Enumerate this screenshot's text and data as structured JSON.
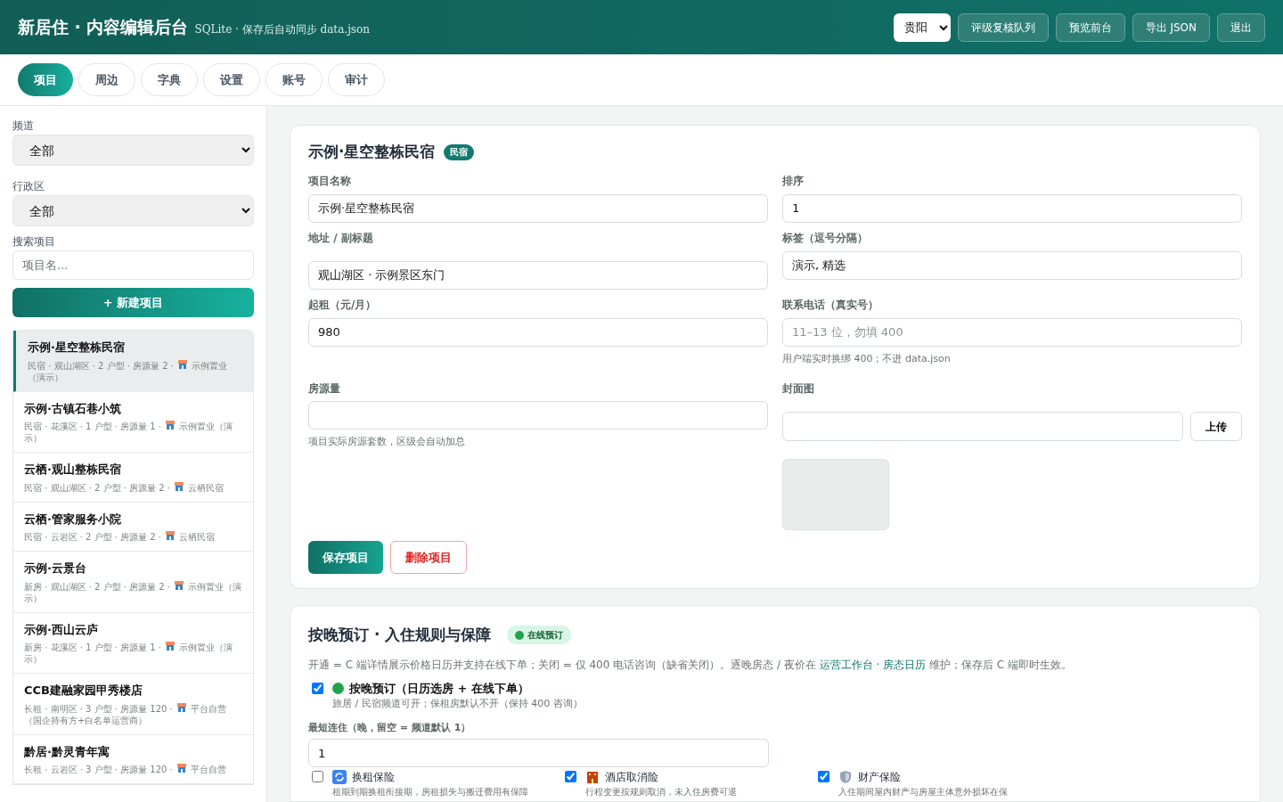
{
  "header": {
    "title": "新居住 · 内容编辑后台",
    "subtitle": "SQLite · 保存后自动同步 data.json",
    "city": "贵阳",
    "buttons": [
      "评级复核队列",
      "预览前台",
      "导出 JSON",
      "退出"
    ]
  },
  "tabs": [
    {
      "label": "项目",
      "selected": true
    },
    {
      "label": "周边",
      "selected": false
    },
    {
      "label": "字典",
      "selected": false
    },
    {
      "label": "设置",
      "selected": false
    },
    {
      "label": "账号",
      "selected": false
    },
    {
      "label": "审计",
      "selected": false
    }
  ],
  "sidebar": {
    "filters": [
      {
        "label": "频道",
        "value": "全部"
      },
      {
        "label": "行政区",
        "value": "全部"
      }
    ],
    "search": {
      "label": "搜索项目",
      "placeholder": "项目名..."
    },
    "new_button": "+ 新建项目",
    "items": [
      {
        "name": "示例·星空整栋民宿",
        "meta": "民宿 · 观山湖区 · 2 户型 · 房源量 2 ·",
        "owner": "示例置业（演示）",
        "selected": true
      },
      {
        "name": "示例·古镇石巷小筑",
        "meta": "民宿 · 花溪区 · 1 户型 · 房源量 1 ·",
        "owner": "示例置业（演示）",
        "selected": false
      },
      {
        "name": "云栖·观山整栋民宿",
        "meta": "民宿 · 观山湖区 · 2 户型 · 房源量 2 ·",
        "owner": "云栖民宿",
        "selected": false
      },
      {
        "name": "云栖·管家服务小院",
        "meta": "民宿 · 云岩区 · 2 户型 · 房源量 2 ·",
        "owner": "云栖民宿",
        "selected": false
      },
      {
        "name": "示例·云景台",
        "meta": "新房 · 观山湖区 · 2 户型 · 房源量 2 ·",
        "owner": "示例置业（演示）",
        "selected": false
      },
      {
        "name": "示例·西山云庐",
        "meta": "新房 · 花溪区 · 1 户型 · 房源量 1 ·",
        "owner": "示例置业（演示）",
        "selected": false
      },
      {
        "name": "CCB建融家园甲秀楼店",
        "meta": "长租 · 南明区 · 3 户型 · 房源量 120 ·",
        "owner": "平台自营（国企持有方+白名单运营商）",
        "selected": false
      },
      {
        "name": "黔居·黔灵青年寓",
        "meta": "长租 · 云岩区 · 3 户型 · 房源量 120 ·",
        "owner": "平台自营",
        "selected": false
      }
    ]
  },
  "project": {
    "title": "示例·星空整栋民宿",
    "badge": "民宿",
    "fields": [
      {
        "label": "项目名称",
        "value": "示例·星空整栋民宿"
      },
      {
        "label": "排序",
        "value": "1"
      },
      {
        "label": "地址 / 副标题",
        "value": "观山湖区 · 示例景区东门"
      },
      {
        "label": "标签（逗号分隔）",
        "value": "演示, 精选"
      },
      {
        "label": "起租（元/月）",
        "value": "980"
      },
      {
        "label": "联系电话（真实号）",
        "placeholder": "11–13 位，勿填 400",
        "hint": "用户端实时换绑 400；不进 data.json"
      },
      {
        "label": "房源量",
        "hint": "项目实际房源套数，区级会自动加总"
      }
    ],
    "cover": {
      "label": "封面图",
      "upload": "上传"
    },
    "save": "保存项目",
    "delete": "删除项目"
  },
  "booking": {
    "title": "按晚预订 · 入住规则与保障",
    "badge": "在线预订",
    "desc_before": "开通 = C 端详情展示价格日历并支持在线下单；关闭 = 仅 400 电话咨询（缺省关闭）。逐晚房态 / 夜价在",
    "link": "运营工作台 · 房态日历",
    "desc_after": "维护；保存后 C 端即时生效。",
    "toggle": {
      "label": "按晚预订（日历选房 + 在线下单）",
      "hint": "旅居 / 民宿频道可开；保租房默认不开（保持 400 咨询）",
      "checked": true
    },
    "min_stay": {
      "label": "最短连住（晚，留空 = 频道默认 1）",
      "value": "1"
    },
    "insurance": [
      {
        "kind": "swap",
        "label": "换租保险",
        "hint": "租期到期换租衔接期，房租损失与搬迁费用有保障",
        "checked": false
      },
      {
        "kind": "hotel",
        "label": "酒店取消险",
        "hint": "行程变更按规则取消，未入住房费可退",
        "checked": true
      },
      {
        "kind": "shield",
        "label": "财产保险",
        "hint": "入住期间屋内财产与房屋主体意外损坏在保",
        "checked": true
      }
    ]
  }
}
